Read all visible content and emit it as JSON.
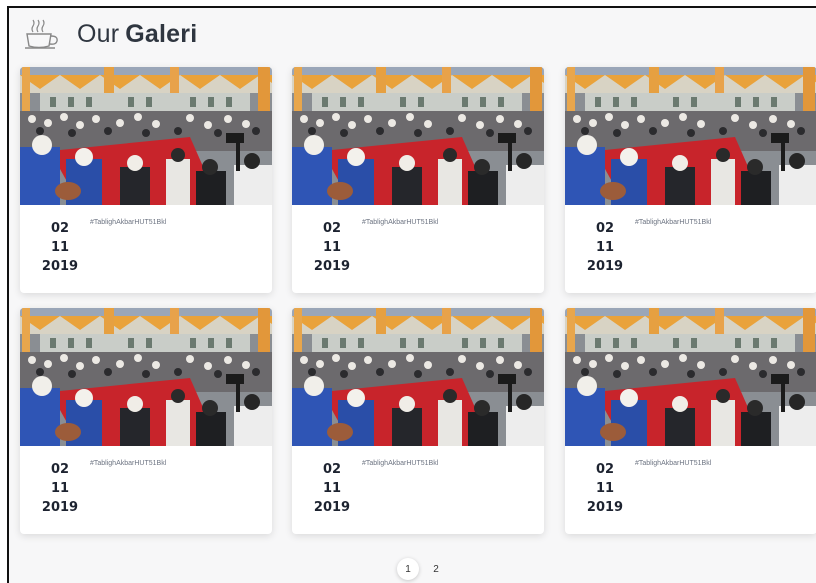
{
  "header": {
    "title_light": "Our",
    "title_bold": "Galeri",
    "icon": "coffee-cup-icon"
  },
  "gallery": {
    "items": [
      {
        "day": "02",
        "month": "11",
        "year": "2019",
        "tag": "#TablighAkbarHUT51Bkl"
      },
      {
        "day": "02",
        "month": "11",
        "year": "2019",
        "tag": "#TablighAkbarHUT51Bkl"
      },
      {
        "day": "02",
        "month": "11",
        "year": "2019",
        "tag": "#TablighAkbarHUT51Bkl"
      },
      {
        "day": "02",
        "month": "11",
        "year": "2019",
        "tag": "#TablighAkbarHUT51Bkl"
      },
      {
        "day": "02",
        "month": "11",
        "year": "2019",
        "tag": "#TablighAkbarHUT51Bkl"
      },
      {
        "day": "02",
        "month": "11",
        "year": "2019",
        "tag": "#TablighAkbarHUT51Bkl"
      }
    ]
  },
  "pagination": {
    "pages": [
      "1",
      "2"
    ],
    "active": "1"
  }
}
